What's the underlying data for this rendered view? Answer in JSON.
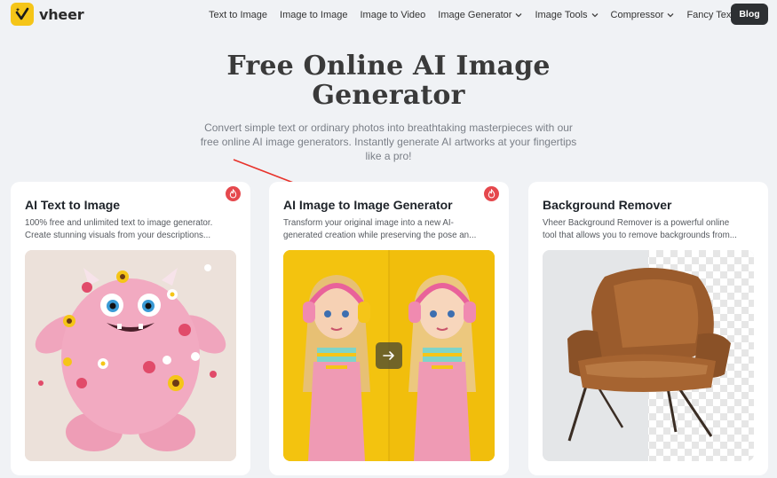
{
  "brand": {
    "name": "vheer",
    "accent": "#f5c518"
  },
  "nav": {
    "items": [
      {
        "label": "Text to Image",
        "dropdown": false
      },
      {
        "label": "Image to Image",
        "dropdown": false
      },
      {
        "label": "Image to Video",
        "dropdown": false
      },
      {
        "label": "Image Generator",
        "dropdown": true
      },
      {
        "label": "Image Tools",
        "dropdown": true
      },
      {
        "label": "Compressor",
        "dropdown": true
      },
      {
        "label": "Fancy Text",
        "dropdown": true
      }
    ],
    "blog_label": "Blog"
  },
  "hero": {
    "title_line1": "Free Online AI Image",
    "title_line2": "Generator",
    "subtitle": "Convert simple text or ordinary photos into breathtaking masterpieces with our free online AI image generators. Instantly generate AI artworks at your fingertips like a pro!"
  },
  "cards": [
    {
      "title": "AI Text to Image",
      "desc_line1": "100% free and unlimited text to image generator.",
      "desc_line2": "Create stunning visuals from your descriptions...",
      "hot": true,
      "hot_icon": "fire-icon",
      "image": "pink-furry-monster-with-flowers"
    },
    {
      "title": "AI Image to Image Generator",
      "desc_line1": "Transform your original image into a new AI-",
      "desc_line2": "generated creation while preserving the pose an...",
      "hot": true,
      "hot_icon": "fire-icon",
      "image": "girl-with-headphones-before-after"
    },
    {
      "title": "Background Remover",
      "desc_line1": "Vheer Background Remover is a powerful online",
      "desc_line2": "tool that allows you to remove backgrounds from...",
      "hot": false,
      "image": "brown-leather-armchair"
    }
  ],
  "colors": {
    "page_bg": "#f0f2f5",
    "blog_bg": "#2d3033",
    "hot_badge": "#e5484d",
    "annotation_arrow": "#e8322a"
  }
}
